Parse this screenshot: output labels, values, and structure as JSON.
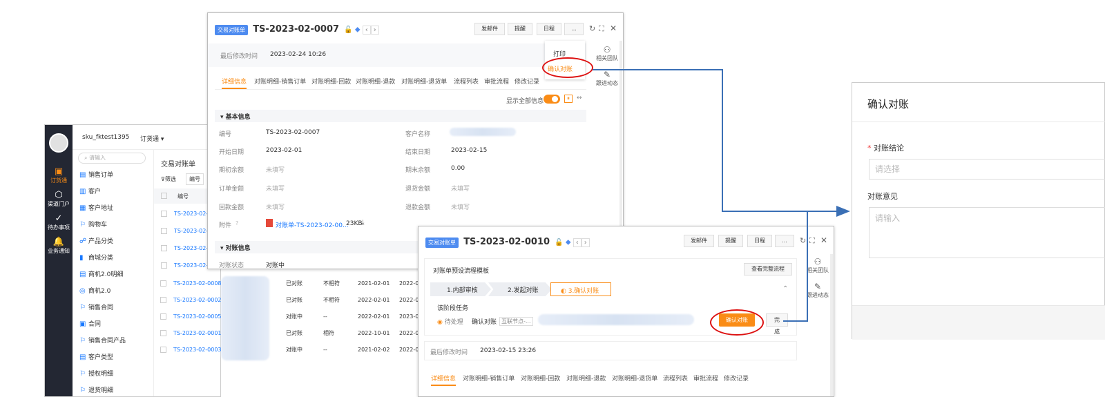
{
  "back_app": {
    "account": "sku_fktest1395",
    "app_switch": "订货通",
    "rail": [
      {
        "icon": "order-icon",
        "label": "订货通"
      },
      {
        "icon": "channel-icon",
        "label": "渠道门户"
      },
      {
        "icon": "todo-icon",
        "label": "待办事项"
      },
      {
        "icon": "bell-icon",
        "label": "业务通知"
      }
    ],
    "search_placeholder": "请输入",
    "menu": [
      "销售订单",
      "客户",
      "客户地址",
      "购物车",
      "产品分类",
      "商城分类",
      "商机2.0明细",
      "商机2.0",
      "销售合同",
      "合同",
      "销售合同产品",
      "客户类型",
      "授权明细",
      "退货明细"
    ],
    "list_title": "交易对账单",
    "filter_label": "筛选",
    "field_select": "编号",
    "col_header": "编号",
    "rows": [
      "TS-2023-02-0",
      "TS-2023-02-0",
      "TS-2023-02-0",
      "TS-2023-02-0",
      "TS-2023-02-0008",
      "TS-2023-02-0002",
      "TS-2023-02-0005",
      "TS-2023-02-0001",
      "TS-2023-02-0003"
    ],
    "extra_rows": [
      {
        "status": "已对账",
        "match": "不相符",
        "date": "2021-02-01",
        "date2": "2022-02"
      },
      {
        "status": "已对账",
        "match": "不相符",
        "date": "2022-02-01",
        "date2": "2022-02"
      },
      {
        "status": "对账中",
        "match": "--",
        "date": "2022-02-01",
        "date2": "2023-03"
      },
      {
        "status": "已对账",
        "match": "相符",
        "date": "2022-10-01",
        "date2": "2022-02"
      },
      {
        "status": "对账中",
        "match": "--",
        "date": "2021-02-02",
        "date2": "2022-02"
      }
    ]
  },
  "win1": {
    "badge": "交易对账单",
    "title": "TS-2023-02-0007",
    "buttons": {
      "send": "发邮件",
      "remind": "提醒",
      "schedule": "日程",
      "more": "..."
    },
    "modified_label": "最后修改时间",
    "modified_value": "2023-02-24 10:26",
    "dropdown": {
      "print": "打印",
      "confirm": "确认对账"
    },
    "side": {
      "team": "相关团队",
      "follow": "跟进动态"
    },
    "tabs": [
      "详细信息",
      "对账明细-销售订单",
      "对账明细-回款",
      "对账明细-退款",
      "对账明细-退货单",
      "流程列表",
      "审批流程",
      "修改记录"
    ],
    "show_all": "显示全部信息",
    "section_basic": "基本信息",
    "fields_left": [
      {
        "label": "编号",
        "value": "TS-2023-02-0007"
      },
      {
        "label": "开始日期",
        "value": "2023-02-01"
      },
      {
        "label": "期初余额",
        "value": "未填写"
      },
      {
        "label": "订单金额",
        "value": "未填写"
      },
      {
        "label": "回款金额",
        "value": "未填写"
      },
      {
        "label": "附件",
        "value": "对账单-TS-2023-02-00...",
        "size": "23KB"
      }
    ],
    "fields_right": [
      {
        "label": "客户名称",
        "value": ""
      },
      {
        "label": "结束日期",
        "value": "2023-02-15"
      },
      {
        "label": "期末余额",
        "value": "0.00"
      },
      {
        "label": "退货金额",
        "value": "未填写"
      },
      {
        "label": "退款金额",
        "value": "未填写"
      }
    ],
    "section_recon": "对账信息",
    "recon_status_label": "对账状态",
    "recon_status_value": "对账中"
  },
  "win2": {
    "badge": "交易对账单",
    "title": "TS-2023-02-0010",
    "buttons": {
      "send": "发邮件",
      "remind": "提醒",
      "schedule": "日程",
      "more": "..."
    },
    "flow_title": "对账单预设流程模板",
    "view_flow": "查看完整流程",
    "steps": [
      "1.内部审核",
      "2.发起对账",
      "3.确认对账"
    ],
    "stage_task": "该阶段任务",
    "pending": "待处理",
    "task": "确认对账",
    "node": "互联节点-...",
    "confirm_btn": "确认对账",
    "done_btn": "完成",
    "modified_label": "最后修改时间",
    "modified_value": "2023-02-15 23:26",
    "side": {
      "team": "相关团队",
      "follow": "跟进动态"
    },
    "tabs": [
      "详细信息",
      "对账明细-销售订单",
      "对账明细-回款",
      "对账明细-退款",
      "对账明细-退货单",
      "流程列表",
      "审批流程",
      "修改记录"
    ]
  },
  "dialog": {
    "title": "确认对账",
    "field1_label": "对账结论",
    "field1_placeholder": "请选择",
    "field2_label": "对账意见",
    "field2_placeholder": "请输入"
  },
  "colors": {
    "accent": "#fa8c16",
    "link": "#1677ff",
    "badge": "#4d8bf0",
    "highlight": "#d11111",
    "connector": "#3a6fb5"
  }
}
